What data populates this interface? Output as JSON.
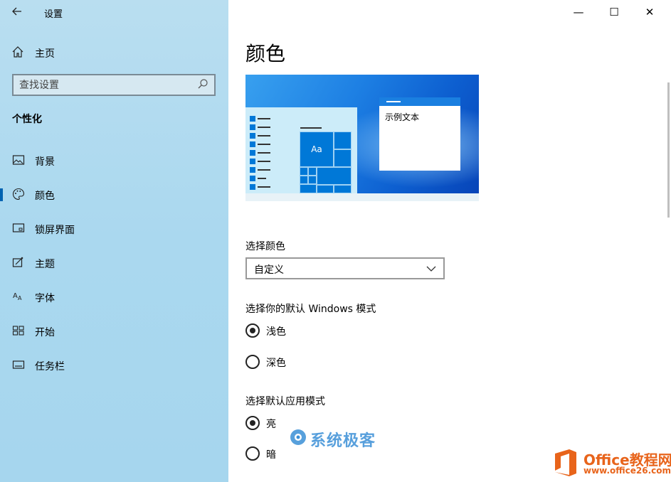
{
  "window": {
    "app_title": "设置",
    "back_icon": "arrow-left-icon",
    "controls": {
      "minimize": "—",
      "maximize": "☐",
      "close": "✕"
    }
  },
  "sidebar": {
    "home_label": "主页",
    "search_placeholder": "查找设置",
    "section_title": "个性化",
    "items": [
      {
        "label": "背景",
        "icon": "picture-icon",
        "active": false
      },
      {
        "label": "颜色",
        "icon": "palette-icon",
        "active": true
      },
      {
        "label": "锁屏界面",
        "icon": "lockscreen-icon",
        "active": false
      },
      {
        "label": "主题",
        "icon": "theme-icon",
        "active": false
      },
      {
        "label": "字体",
        "icon": "font-icon",
        "active": false
      },
      {
        "label": "开始",
        "icon": "start-icon",
        "active": false
      },
      {
        "label": "任务栏",
        "icon": "taskbar-icon",
        "active": false
      }
    ]
  },
  "main": {
    "title": "颜色",
    "preview": {
      "sample_text": "示例文本",
      "tile_text": "Aa"
    },
    "choose_color_label": "选择颜色",
    "choose_color_value": "自定义",
    "windows_mode_label": "选择你的默认 Windows 模式",
    "windows_mode_options": [
      {
        "label": "浅色",
        "selected": true
      },
      {
        "label": "深色",
        "selected": false
      }
    ],
    "app_mode_label": "选择默认应用模式",
    "app_mode_options": [
      {
        "label": "亮",
        "selected": true
      },
      {
        "label": "暗",
        "selected": false
      }
    ]
  },
  "watermarks": {
    "site1": "系统极客",
    "site2_title": "Office教程网",
    "site2_url": "www.office26.com"
  },
  "colors": {
    "accent": "#0078d7",
    "sidebar_bg": "#aad8ef",
    "office_orange": "#e8641b"
  }
}
